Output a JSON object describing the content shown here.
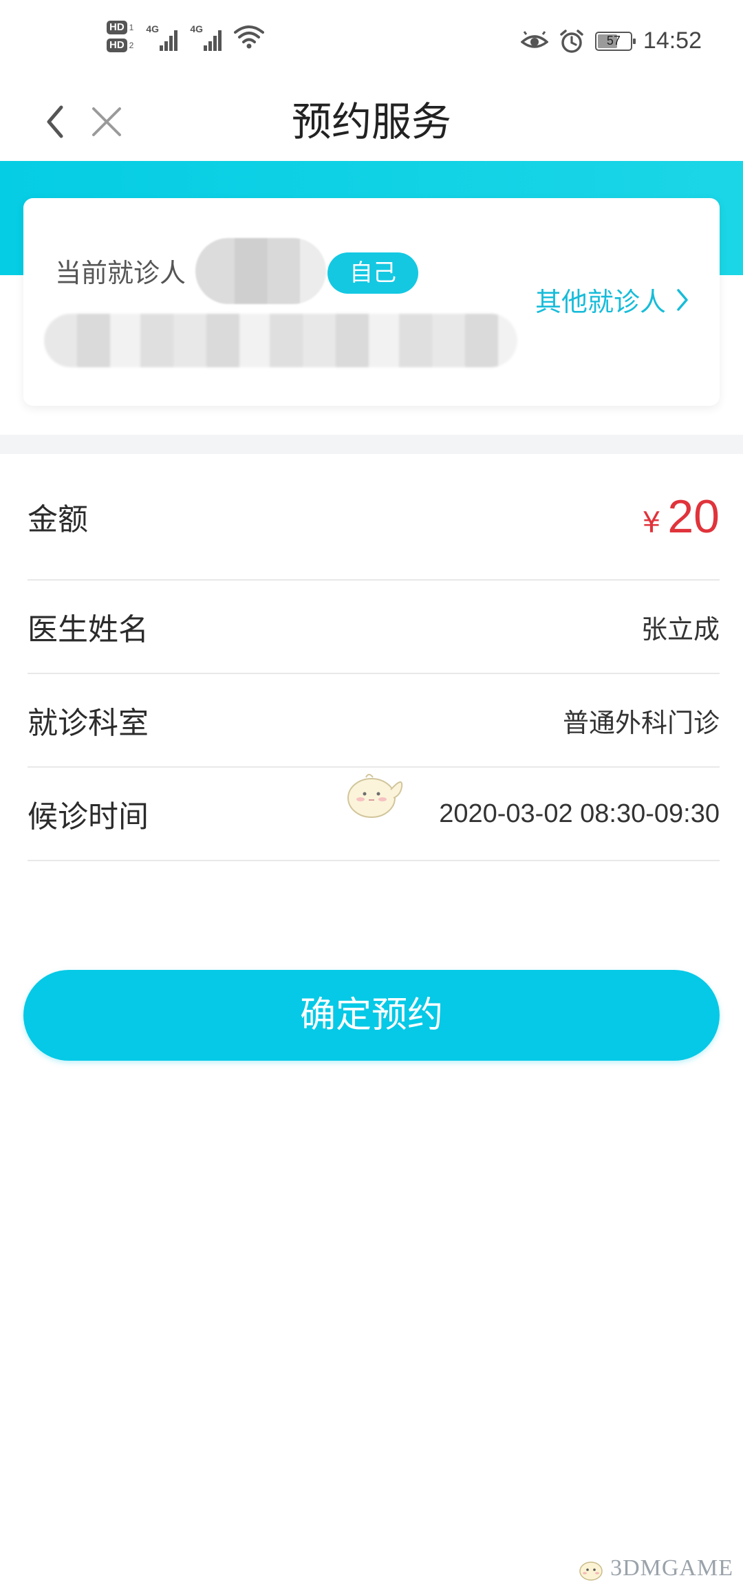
{
  "status_bar": {
    "sim1": "HD",
    "sim1_index": "1",
    "sim2": "HD",
    "sim2_index": "2",
    "network1": "4G",
    "network2": "4G",
    "battery": "57",
    "time": "14:52",
    "icons": [
      "eye-icon",
      "alarm-icon",
      "wifi-icon",
      "signal-icon",
      "battery-icon"
    ]
  },
  "nav": {
    "title": "预约服务",
    "back_icon": "chevron-left-icon",
    "close_icon": "close-icon"
  },
  "patient": {
    "label": "当前就诊人",
    "relation_tag": "自己",
    "other_link": "其他就诊人"
  },
  "details": {
    "amount_label": "金额",
    "currency": "¥",
    "amount_value": "20",
    "doctor_label": "医生姓名",
    "doctor_value": "张立成",
    "department_label": "就诊科室",
    "department_value": "普通外科门诊",
    "time_label": "候诊时间",
    "time_value": "2020-03-02 08:30-09:30"
  },
  "actions": {
    "confirm_label": "确定预约"
  },
  "watermark": {
    "logo_text": "3DMGAME"
  },
  "colors": {
    "accent": "#05c9e6",
    "price": "#e0333b",
    "link": "#17bcd9"
  }
}
